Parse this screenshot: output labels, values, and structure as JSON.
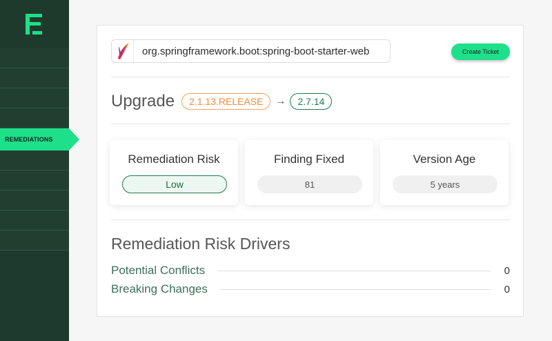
{
  "sidebar": {
    "logo_icon": "brand-e-logo",
    "active_item_label": "REMEDIATIONS",
    "accent_color": "#1ee08a"
  },
  "package": {
    "icon": "apache-feather-icon",
    "name": "org.springframework.boot:spring-boot-starter-web"
  },
  "actions": {
    "create_ticket_label": "Create Ticket"
  },
  "upgrade": {
    "title": "Upgrade",
    "from_version": "2.1.13.RELEASE",
    "arrow": "→",
    "to_version": "2.7.14"
  },
  "metrics": [
    {
      "title": "Remediation Risk",
      "value": "Low"
    },
    {
      "title": "Finding Fixed",
      "value": "81"
    },
    {
      "title": "Version Age",
      "value": "5 years"
    }
  ],
  "drivers": {
    "title": "Remediation Risk Drivers",
    "items": [
      {
        "label": "Potential Conflicts",
        "value": "0"
      },
      {
        "label": "Breaking Changes",
        "value": "0"
      }
    ]
  }
}
